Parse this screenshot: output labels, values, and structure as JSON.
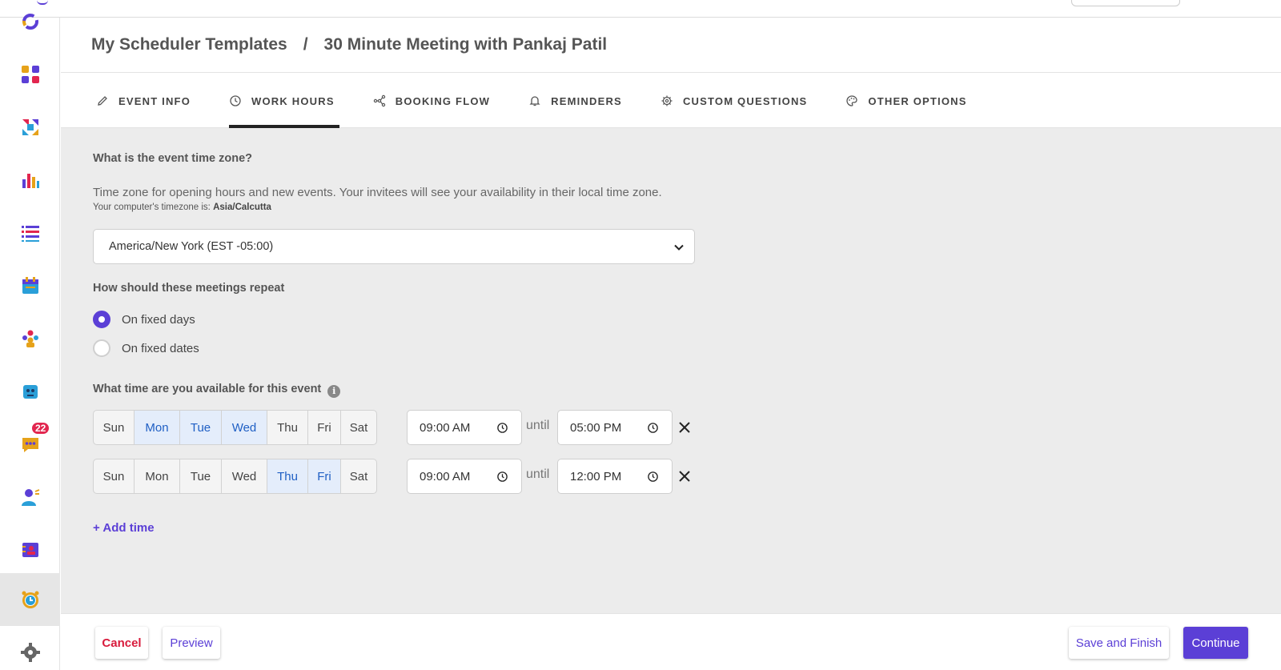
{
  "breadcrumb": {
    "root": "My Scheduler Templates",
    "separator": "/",
    "current": "30 Minute Meeting with Pankaj Patil"
  },
  "tabs": [
    {
      "label": "EVENT INFO",
      "icon": "pencil-icon",
      "active": false
    },
    {
      "label": "WORK HOURS",
      "icon": "clock-icon",
      "active": true
    },
    {
      "label": "BOOKING FLOW",
      "icon": "flow-icon",
      "active": false
    },
    {
      "label": "REMINDERS",
      "icon": "bell-icon",
      "active": false
    },
    {
      "label": "CUSTOM QUESTIONS",
      "icon": "gear-icon",
      "active": false
    },
    {
      "label": "OTHER OPTIONS",
      "icon": "palette-icon",
      "active": false
    }
  ],
  "sidebar": {
    "chat_badge": "22",
    "active_item": "scheduler"
  },
  "timezone": {
    "question": "What is the event time zone?",
    "description": "Time zone for opening hours and new events. Your invitees will see your availability in their local time zone.",
    "computer_tz_label": "Your computer's timezone is:",
    "computer_tz_value": "Asia/Calcutta",
    "selected": "America/New York (EST -05:00)"
  },
  "repeat": {
    "question": "How should these meetings repeat",
    "options": [
      {
        "label": "On fixed days",
        "selected": true
      },
      {
        "label": "On fixed dates",
        "selected": false
      }
    ]
  },
  "availability": {
    "question": "What time are you available for this event",
    "info_icon": "i",
    "until_label": "until",
    "rows": [
      {
        "days": [
          {
            "label": "Sun",
            "selected": false
          },
          {
            "label": "Mon",
            "selected": true
          },
          {
            "label": "Tue",
            "selected": true
          },
          {
            "label": "Wed",
            "selected": true
          },
          {
            "label": "Thu",
            "selected": false
          },
          {
            "label": "Fri",
            "selected": false
          },
          {
            "label": "Sat",
            "selected": false
          }
        ],
        "start": "09:00 AM",
        "end": "05:00 PM"
      },
      {
        "days": [
          {
            "label": "Sun",
            "selected": false
          },
          {
            "label": "Mon",
            "selected": false
          },
          {
            "label": "Tue",
            "selected": false
          },
          {
            "label": "Wed",
            "selected": false
          },
          {
            "label": "Thu",
            "selected": true
          },
          {
            "label": "Fri",
            "selected": true
          },
          {
            "label": "Sat",
            "selected": false
          }
        ],
        "start": "09:00 AM",
        "end": "12:00 PM"
      }
    ],
    "add_time": "+ Add time"
  },
  "footer": {
    "cancel": "Cancel",
    "preview": "Preview",
    "save_finish": "Save and Finish",
    "continue": "Continue"
  },
  "colors": {
    "accent": "#5b3fd6",
    "danger": "#d81b3c",
    "selected_day_text": "#1f5fc4",
    "selected_day_bg": "#e4edfb"
  }
}
